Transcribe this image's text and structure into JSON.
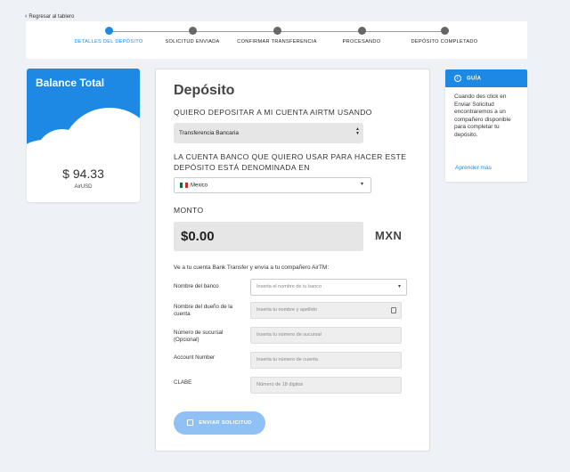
{
  "nav": {
    "back_label": "Regresar al tablero"
  },
  "steps": [
    {
      "label": "DETALLES DEL DEPÓSITO",
      "active": true
    },
    {
      "label": "SOLICITUD ENVIADA",
      "active": false
    },
    {
      "label": "CONFIRMAR TRANSFERENCIA",
      "active": false
    },
    {
      "label": "PROCESANDO",
      "active": false
    },
    {
      "label": "DEPÓSITO COMPLETADO",
      "active": false
    }
  ],
  "balance": {
    "title": "Balance Total",
    "amount": "$ 94.33",
    "currency": "AirUSD"
  },
  "deposit": {
    "title": "Depósito",
    "method_question": "QUIERO DEPOSITAR A MI CUENTA AIRTM USANDO",
    "method_value": "Transferencia Bancaria",
    "currency_question": "LA CUENTA BANCO QUE QUIERO USAR PARA HACER ESTE DEPÓSITO ESTÁ DENOMINADA EN",
    "country_value": "Mexico",
    "amount_label": "MONTO",
    "amount_value": "$0.00",
    "amount_currency": "MXN",
    "instructions": "Ve a tu cuenta Bank Transfer y envía a tu compañero AirTM:",
    "fields": {
      "bank_label": "Nombre del banco",
      "bank_placeholder": "Inserta el nombre de tu banco",
      "owner_label": "Nombre del dueño de la cuenta",
      "owner_placeholder": "Inserta tu nombre y apellido",
      "branch_label": "Número de sucursal (Opcional)",
      "branch_placeholder": "Inserta tu número de sucursal",
      "account_label": "Account Number",
      "account_placeholder": "Inserta tu número de cuenta",
      "clabe_label": "CLABE",
      "clabe_placeholder": "Número de 18 digitos"
    },
    "submit_label": "ENVIAR SOLICITUD"
  },
  "guide": {
    "title": "GUÍA",
    "body": "Cuando des click en Enviar Solicitud encontraremos a un compañero disponible para completar tu depósito.",
    "link": "Aprender más"
  },
  "colors": {
    "accent": "#1e88e5",
    "button_disabled": "#8fc1f5",
    "background": "#eef1f6"
  }
}
